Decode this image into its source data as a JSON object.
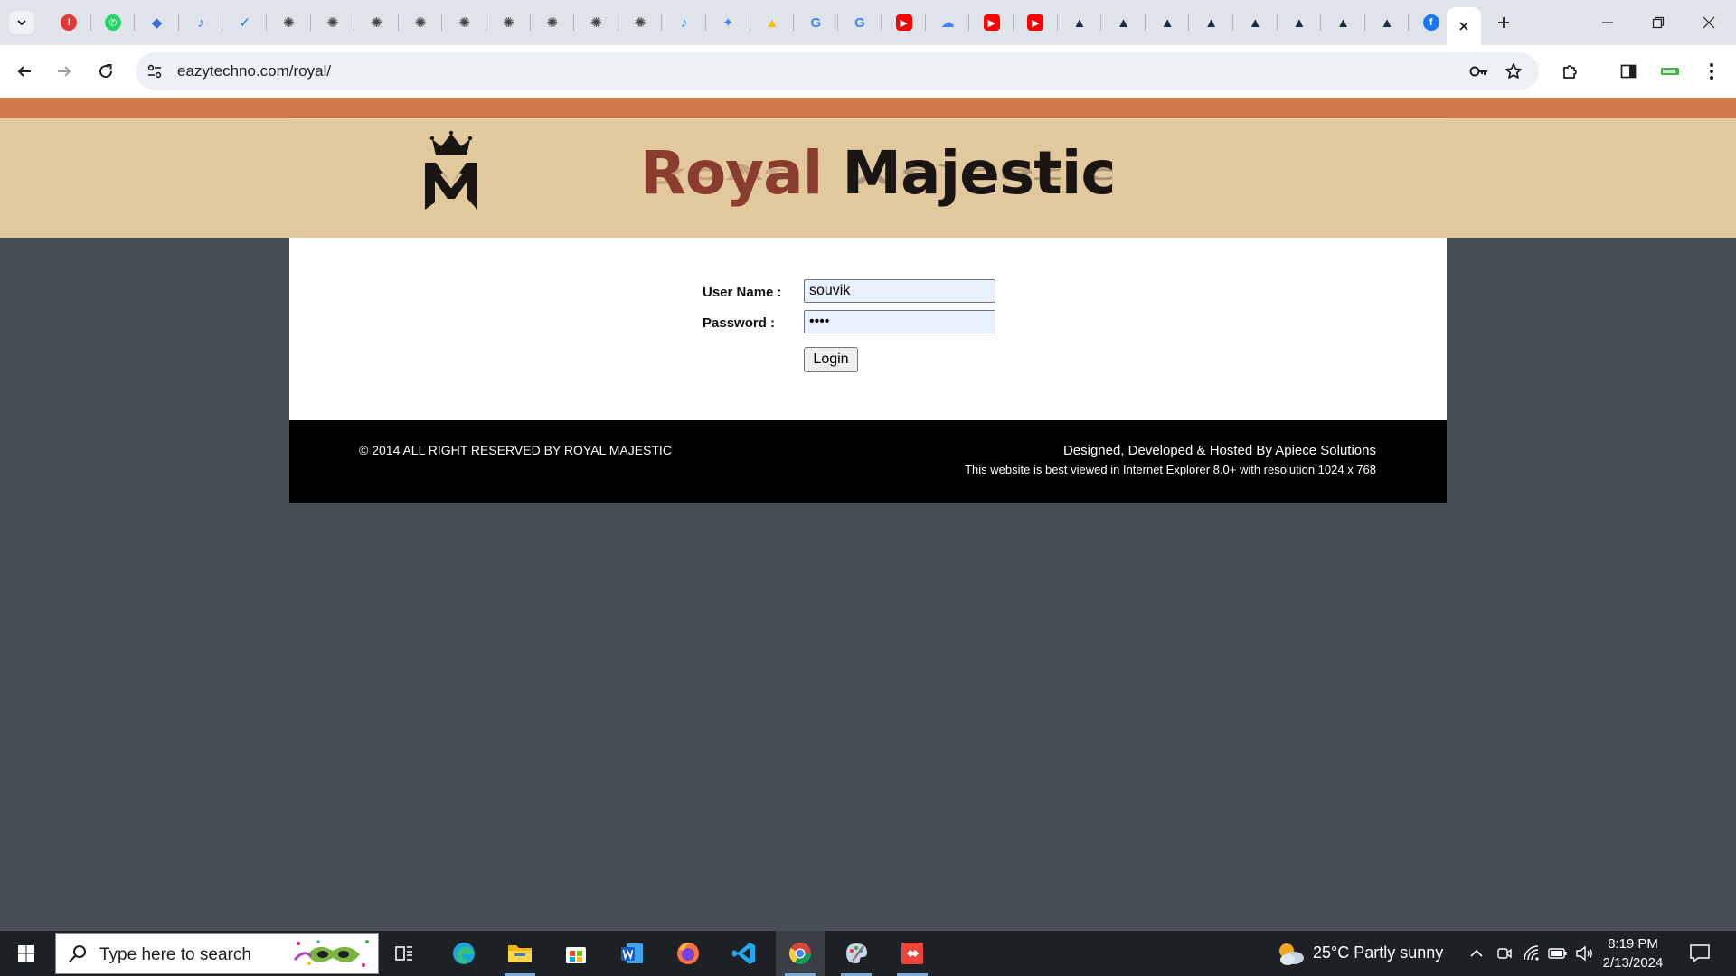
{
  "browser": {
    "url": "eazytechno.com/royal/",
    "pinned_tabs": [
      {
        "icon": "alert-icon",
        "color": "#e53935"
      },
      {
        "icon": "whatsapp-icon",
        "color": "#25d366"
      },
      {
        "icon": "cube-icon",
        "color": "#3b6fd8"
      },
      {
        "icon": "codex-icon",
        "color": "#3c7bd6"
      },
      {
        "icon": "tasks-icon",
        "color": "#1a73e8"
      },
      {
        "icon": "chatgpt-icon",
        "color": "#444"
      },
      {
        "icon": "chatgpt-icon",
        "color": "#444"
      },
      {
        "icon": "chatgpt-icon",
        "color": "#444"
      },
      {
        "icon": "chatgpt-icon",
        "color": "#444"
      },
      {
        "icon": "chatgpt-icon",
        "color": "#444"
      },
      {
        "icon": "chatgpt-icon",
        "color": "#444"
      },
      {
        "icon": "chatgpt-icon",
        "color": "#444"
      },
      {
        "icon": "chatgpt-icon",
        "color": "#444"
      },
      {
        "icon": "chatgpt-icon",
        "color": "#444"
      },
      {
        "icon": "codex-icon",
        "color": "#3c7bd6"
      },
      {
        "icon": "gemini-icon",
        "color": "#4285f4"
      },
      {
        "icon": "google-drive-icon",
        "color": "#fbbc04"
      },
      {
        "icon": "google-icon",
        "color": "#4285f4"
      },
      {
        "icon": "google-icon",
        "color": "#4285f4"
      },
      {
        "icon": "youtube-icon",
        "color": "#ff0000"
      },
      {
        "icon": "google-cloud-icon",
        "color": "#4285f4"
      },
      {
        "icon": "youtube-icon",
        "color": "#ff0000"
      },
      {
        "icon": "youtube-icon",
        "color": "#ff0000"
      },
      {
        "icon": "php-icon",
        "color": "#1c2a48"
      },
      {
        "icon": "php-icon",
        "color": "#1c2a48"
      },
      {
        "icon": "php-icon",
        "color": "#1c2a48"
      },
      {
        "icon": "php-icon",
        "color": "#1c2a48"
      },
      {
        "icon": "php-icon",
        "color": "#1c2a48"
      },
      {
        "icon": "php-icon",
        "color": "#1c2a48"
      },
      {
        "icon": "php-icon",
        "color": "#1c2a48"
      },
      {
        "icon": "php-icon",
        "color": "#1c2a48"
      },
      {
        "icon": "facebook-icon",
        "color": "#1877f2"
      }
    ]
  },
  "site": {
    "brand_word1": "Royal",
    "brand_word2": "Majestic",
    "logo_letters": "RM",
    "colors": {
      "accent": "#d07a4b",
      "header": "#e2c89d",
      "brand_red": "#8a3d2f",
      "body_bg": "#474e56"
    }
  },
  "login": {
    "username_label": "User Name :",
    "username_value": "souvik",
    "password_label": "Password :",
    "password_value": "abcd",
    "button_label": "Login"
  },
  "footer": {
    "copyright": "© 2014 ALL RIGHT RESERVED BY ROYAL MAJESTIC",
    "credit": "Designed, Developed & Hosted By Apiece Solutions",
    "note": "This website is best viewed in Internet Explorer 8.0+ with resolution 1024 x 768"
  },
  "taskbar": {
    "search_placeholder": "Type here to search",
    "weather": "25°C  Partly sunny",
    "time": "8:19 PM",
    "date": "2/13/2024"
  }
}
